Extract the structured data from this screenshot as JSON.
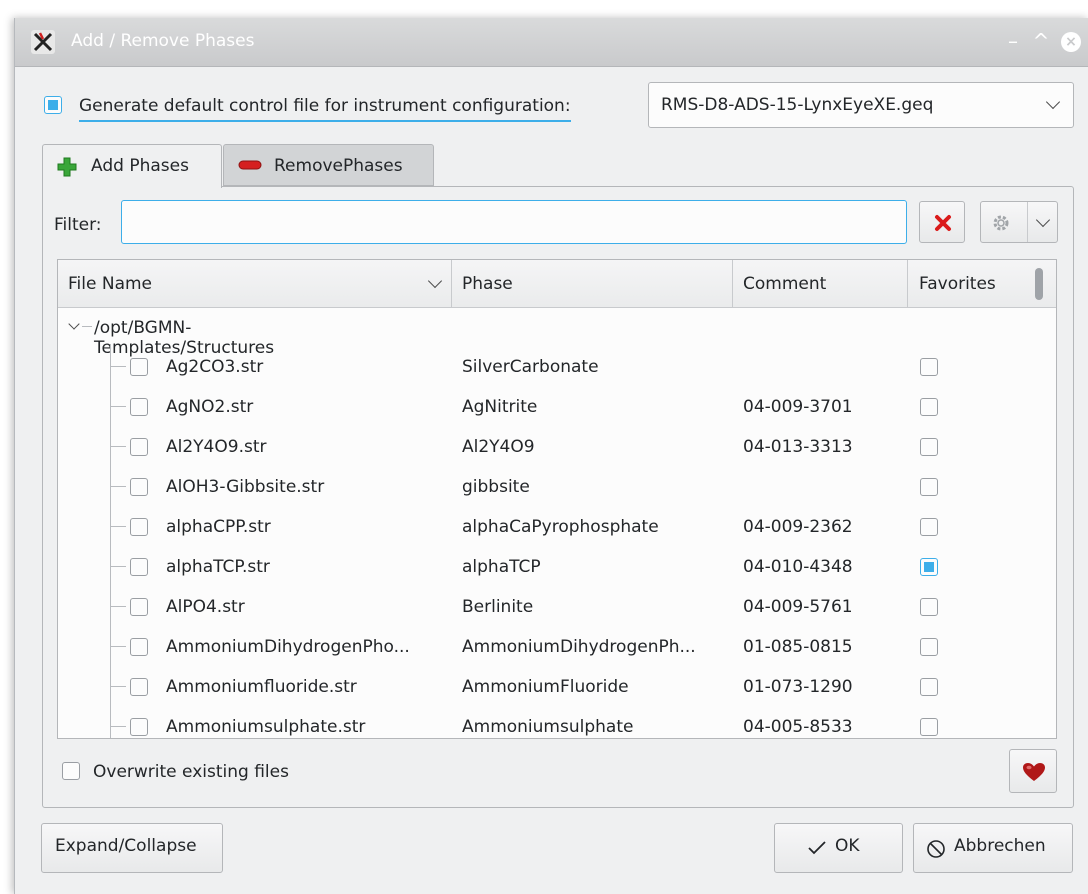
{
  "window": {
    "title": "Add / Remove Phases",
    "controls": {
      "minimize": "–",
      "maximize": "^",
      "close": "×"
    }
  },
  "config": {
    "generate_label": "Generate default control file for instrument configuration:",
    "generate_checked": true,
    "instrument_file": "RMS-D8-ADS-15-LynxEyeXE.geq"
  },
  "tabs": [
    {
      "label": "Add Phases",
      "icon": "green-plus-icon",
      "active": true
    },
    {
      "label": "RemovePhases",
      "icon": "red-minus-icon",
      "active": false
    }
  ],
  "filter": {
    "label": "Filter:",
    "value": "",
    "placeholder": ""
  },
  "table": {
    "columns": [
      "File Name",
      "Phase",
      "Comment",
      "Favorites"
    ],
    "root": "/opt/BGMN-Templates/Structures",
    "rows": [
      {
        "file": "Ag2CO3.str",
        "phase": "SilverCarbonate",
        "comment": "",
        "favorite": false
      },
      {
        "file": "AgNO2.str",
        "phase": "AgNitrite",
        "comment": "04-009-3701",
        "favorite": false
      },
      {
        "file": "Al2Y4O9.str",
        "phase": "Al2Y4O9",
        "comment": "04-013-3313",
        "favorite": false
      },
      {
        "file": "AlOH3-Gibbsite.str",
        "phase": "gibbsite",
        "comment": "",
        "favorite": false
      },
      {
        "file": "alphaCPP.str",
        "phase": "alphaCaPyrophosphate",
        "comment": "04-009-2362",
        "favorite": false
      },
      {
        "file": "alphaTCP.str",
        "phase": "alphaTCP",
        "comment": "04-010-4348",
        "favorite": true
      },
      {
        "file": "AlPO4.str",
        "phase": "Berlinite",
        "comment": "04-009-5761",
        "favorite": false
      },
      {
        "file": "AmmoniumDihydrogenPho...",
        "phase": "AmmoniumDihydrogenPh...",
        "comment": "01-085-0815",
        "favorite": false
      },
      {
        "file": "Ammoniumfluoride.str",
        "phase": "AmmoniumFluoride",
        "comment": "01-073-1290",
        "favorite": false
      },
      {
        "file": "Ammoniumsulphate.str",
        "phase": "Ammoniumsulphate",
        "comment": "04-005-8533",
        "favorite": false
      }
    ]
  },
  "options": {
    "overwrite_label": "Overwrite existing files",
    "overwrite_checked": false
  },
  "footer": {
    "expand_label": "Expand/Collapse",
    "ok_label": "OK",
    "cancel_label": "Abbrechen"
  },
  "colors": {
    "accent": "#3daee9",
    "clear_red": "#da1b1b",
    "heart_red": "#b01818"
  }
}
